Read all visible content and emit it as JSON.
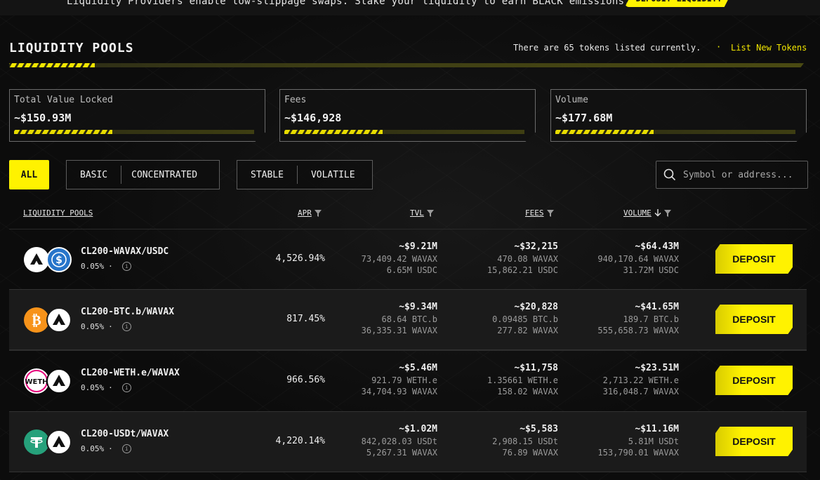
{
  "banner": {
    "text": "Liquidity Providers enable low-slippage swaps. Stake your liquidity to earn BLACK emissions.",
    "button_label": "DEPOSIT LIQUIDITY"
  },
  "header": {
    "title": "LIQUIDITY POOLS",
    "tokens_note": "There are 65 tokens listed currently.",
    "separator": "·",
    "list_link": "List New Tokens"
  },
  "stats": [
    {
      "label": "Total Value Locked",
      "value": "~$150.93M"
    },
    {
      "label": "Fees",
      "value": "~$146,928"
    },
    {
      "label": "Volume",
      "value": "~$177.68M"
    }
  ],
  "filters": {
    "all": "ALL",
    "group1": [
      "BASIC",
      "CONCENTRATED"
    ],
    "group2": [
      "STABLE",
      "VOLATILE"
    ]
  },
  "search": {
    "placeholder": "Symbol or address...",
    "icon": "search-icon"
  },
  "table": {
    "headers": {
      "pools": "LIQUIDITY POOLS",
      "apr": "APR",
      "tvl": "TVL",
      "fees": "FEES",
      "volume": "VOLUME"
    },
    "rows": [
      {
        "name": "CL200-WAVAX/USDC",
        "fee": "0.05%",
        "sep": "·",
        "token_a": "avalanche",
        "token_b": "usdc",
        "apr": "4,526.94%",
        "tvl": "~$9.21M",
        "tvl_a": "73,409.42 WAVAX",
        "tvl_b": "6.65M USDC",
        "fees": "~$32,215",
        "fees_a": "470.08 WAVAX",
        "fees_b": "15,862.21 USDC",
        "volume": "~$64.43M",
        "volume_a": "940,170.64 WAVAX",
        "volume_b": "31.72M USDC",
        "action": "DEPOSIT"
      },
      {
        "name": "CL200-BTC.b/WAVAX",
        "fee": "0.05%",
        "sep": "·",
        "token_a": "bitcoin",
        "token_b": "avalanche",
        "apr": "817.45%",
        "tvl": "~$9.34M",
        "tvl_a": "68.64 BTC.b",
        "tvl_b": "36,335.31 WAVAX",
        "fees": "~$20,828",
        "fees_a": "0.09485 BTC.b",
        "fees_b": "277.82 WAVAX",
        "volume": "~$41.65M",
        "volume_a": "189.7 BTC.b",
        "volume_b": "555,658.73 WAVAX",
        "action": "DEPOSIT"
      },
      {
        "name": "CL200-WETH.e/WAVAX",
        "fee": "0.05%",
        "sep": "·",
        "token_a": "weth",
        "token_b": "avalanche",
        "apr": "966.56%",
        "tvl": "~$5.46M",
        "tvl_a": "921.79 WETH.e",
        "tvl_b": "34,704.93 WAVAX",
        "fees": "~$11,758",
        "fees_a": "1.35661 WETH.e",
        "fees_b": "158.02 WAVAX",
        "volume": "~$23.51M",
        "volume_a": "2,713.22 WETH.e",
        "volume_b": "316,048.7 WAVAX",
        "action": "DEPOSIT"
      },
      {
        "name": "CL200-USDt/WAVAX",
        "fee": "0.05%",
        "sep": "·",
        "token_a": "tether",
        "token_b": "avalanche",
        "apr": "4,220.14%",
        "tvl": "~$1.02M",
        "tvl_a": "842,028.03 USDt",
        "tvl_b": "5,267.31 WAVAX",
        "fees": "~$5,583",
        "fees_a": "2,908.15 USDt",
        "fees_b": "76.89 WAVAX",
        "volume": "~$11.16M",
        "volume_a": "5.81M USDt",
        "volume_b": "153,790.01 WAVAX",
        "action": "DEPOSIT"
      }
    ]
  },
  "colors": {
    "accent": "#fff200",
    "background": "#0c0c0c",
    "row_alt": "#1b1b1b"
  }
}
